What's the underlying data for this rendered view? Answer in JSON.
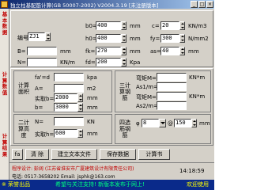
{
  "window": {
    "title": "独立柱基配筋计算(GB 50007-2002) V2004.3.19 [未注册版本]",
    "minimize": "_",
    "maximize": "□",
    "close": "×"
  },
  "sidebar": {
    "top_text": "基本数据",
    "mid_text": "计算数值",
    "bottom_text": "计算结果"
  },
  "inputs": {
    "bianhao": {
      "label": "编号",
      "value": "ZJ1"
    },
    "b0": {
      "label": "b0=",
      "value": "400",
      "unit": "mm"
    },
    "c": {
      "label": "c=",
      "value": "20",
      "unit": "KN/m3"
    },
    "h0": {
      "label": "h0=",
      "value": "400",
      "unit": "mm"
    },
    "fy": {
      "label": "fy=",
      "value": "300",
      "unit": "N/mm2"
    },
    "B": {
      "label": "B=",
      "unit": "mm"
    },
    "fk": {
      "label": "fk=",
      "value": "270",
      "unit": "mm"
    },
    "as": {
      "label": "as=",
      "value": "40",
      "unit": "mm"
    },
    "N": {
      "label": "N=",
      "unit": "KN/m"
    },
    "fd": {
      "label": "fd=",
      "value": "200",
      "unit": "Kpa"
    }
  },
  "calc_area": {
    "title": "计算面积",
    "fa": {
      "label": "fa'=d",
      "unit": "kpa"
    },
    "A": {
      "label": "A=",
      "unit": "m2"
    },
    "shiju": {
      "label": "实取b=",
      "value": "2000",
      "unit": "mm"
    },
    "b": {
      "label": "b=",
      "value": "3000",
      "unit": "mm"
    }
  },
  "calc_height": {
    "title": "二计算高度",
    "N": {
      "label": "N=",
      "unit": "KN"
    },
    "shiju": {
      "label": "实取h=",
      "value": "600",
      "unit": "mm"
    }
  },
  "calc_rebar": {
    "title": "三计算钢筋",
    "r1": {
      "label": "弯矩M=",
      "unit": "KN*m"
    },
    "r2": {
      "label": "As1/m="
    },
    "r3": {
      "label": "弯矩M=",
      "unit": "KN*m"
    },
    "r4": {
      "label": "As2/m="
    }
  },
  "select_rebar": {
    "title": "四选筋钢筋",
    "combo": {
      "label": "φ",
      "value": "8"
    },
    "spacing": {
      "label": "@",
      "value": "150"
    },
    "unit": "mm"
  },
  "buttons": {
    "fa": "fa",
    "clear": "清 除",
    "build": "建立文本文件",
    "save": "保存数据",
    "calc": "计算书"
  },
  "status": {
    "designer": "程序设计: 彭阔 (江苏省淮安市广厦建筑设计有限责任公司)",
    "contact": "电话: 0517-3658202  Email: jsphk@163.com",
    "time": "14:18:59"
  },
  "footer": {
    "left": "※ 荣誉出品",
    "center": "希望与关注支持! 新版本发布于网上!",
    "right": "欢迎使用"
  }
}
